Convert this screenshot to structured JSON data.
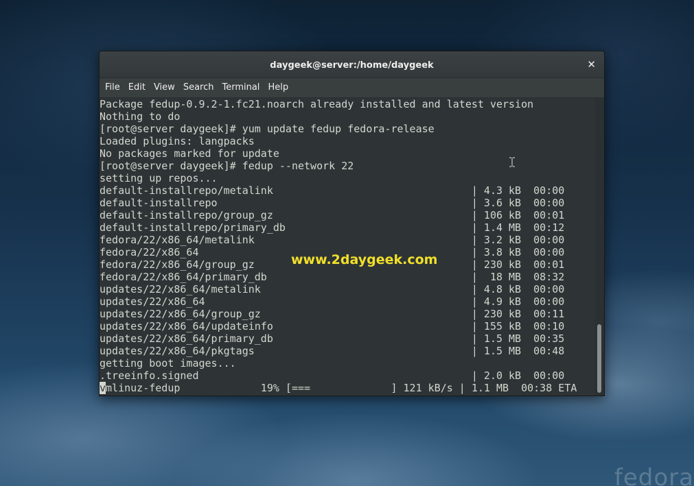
{
  "window": {
    "title": "daygeek@server:/home/daygeek",
    "close_icon": "close-icon",
    "close_glyph": "✕"
  },
  "menu": {
    "items": [
      "File",
      "Edit",
      "View",
      "Search",
      "Terminal",
      "Help"
    ]
  },
  "terminal": {
    "lines": [
      "Package fedup-0.9.2-1.fc21.noarch already installed and latest version",
      "Nothing to do",
      "[root@server daygeek]# yum update fedup fedora-release",
      "Loaded plugins: langpacks",
      "No packages marked for update",
      "[root@server daygeek]# fedup --network 22",
      "setting up repos...",
      "default-installrepo/metalink                                | 4.3 kB  00:00",
      "default-installrepo                                         | 3.6 kB  00:00",
      "default-installrepo/group_gz                                | 106 kB  00:01",
      "default-installrepo/primary_db                              | 1.4 MB  00:12",
      "fedora/22/x86_64/metalink                                   | 3.2 kB  00:00",
      "fedora/22/x86_64                                            | 3.8 kB  00:00",
      "fedora/22/x86_64/group_gz                                   | 230 kB  00:01",
      "fedora/22/x86_64/primary_db                                 |  18 MB  08:32",
      "updates/22/x86_64/metalink                                  | 4.8 kB  00:00",
      "updates/22/x86_64                                           | 4.9 kB  00:00",
      "updates/22/x86_64/group_gz                                  | 230 kB  00:11",
      "updates/22/x86_64/updateinfo                                | 155 kB  00:10",
      "updates/22/x86_64/primary_db                                | 1.5 MB  00:35",
      "updates/22/x86_64/pkgtags                                   | 1.5 MB  00:48",
      "getting boot images...",
      ".treeinfo.signed                                            | 2.0 kB  00:00"
    ],
    "progress_line": {
      "cursor_char": "v",
      "rest": "mlinuz-fedup             19% [===             ] 121 kB/s | 1.1 MB  00:38 ETA"
    },
    "download_progress_percent": 19
  },
  "watermark": "www.2daygeek.com",
  "desktop": {
    "logo_text": "fedora"
  },
  "colors": {
    "terminal_bg": "#2e3436",
    "terminal_fg": "#d3d7cf",
    "watermark": "#f2e02a",
    "titlebar": "#393f3f"
  },
  "icons": {
    "mouse_pointer": "ibeam-cursor-icon"
  }
}
